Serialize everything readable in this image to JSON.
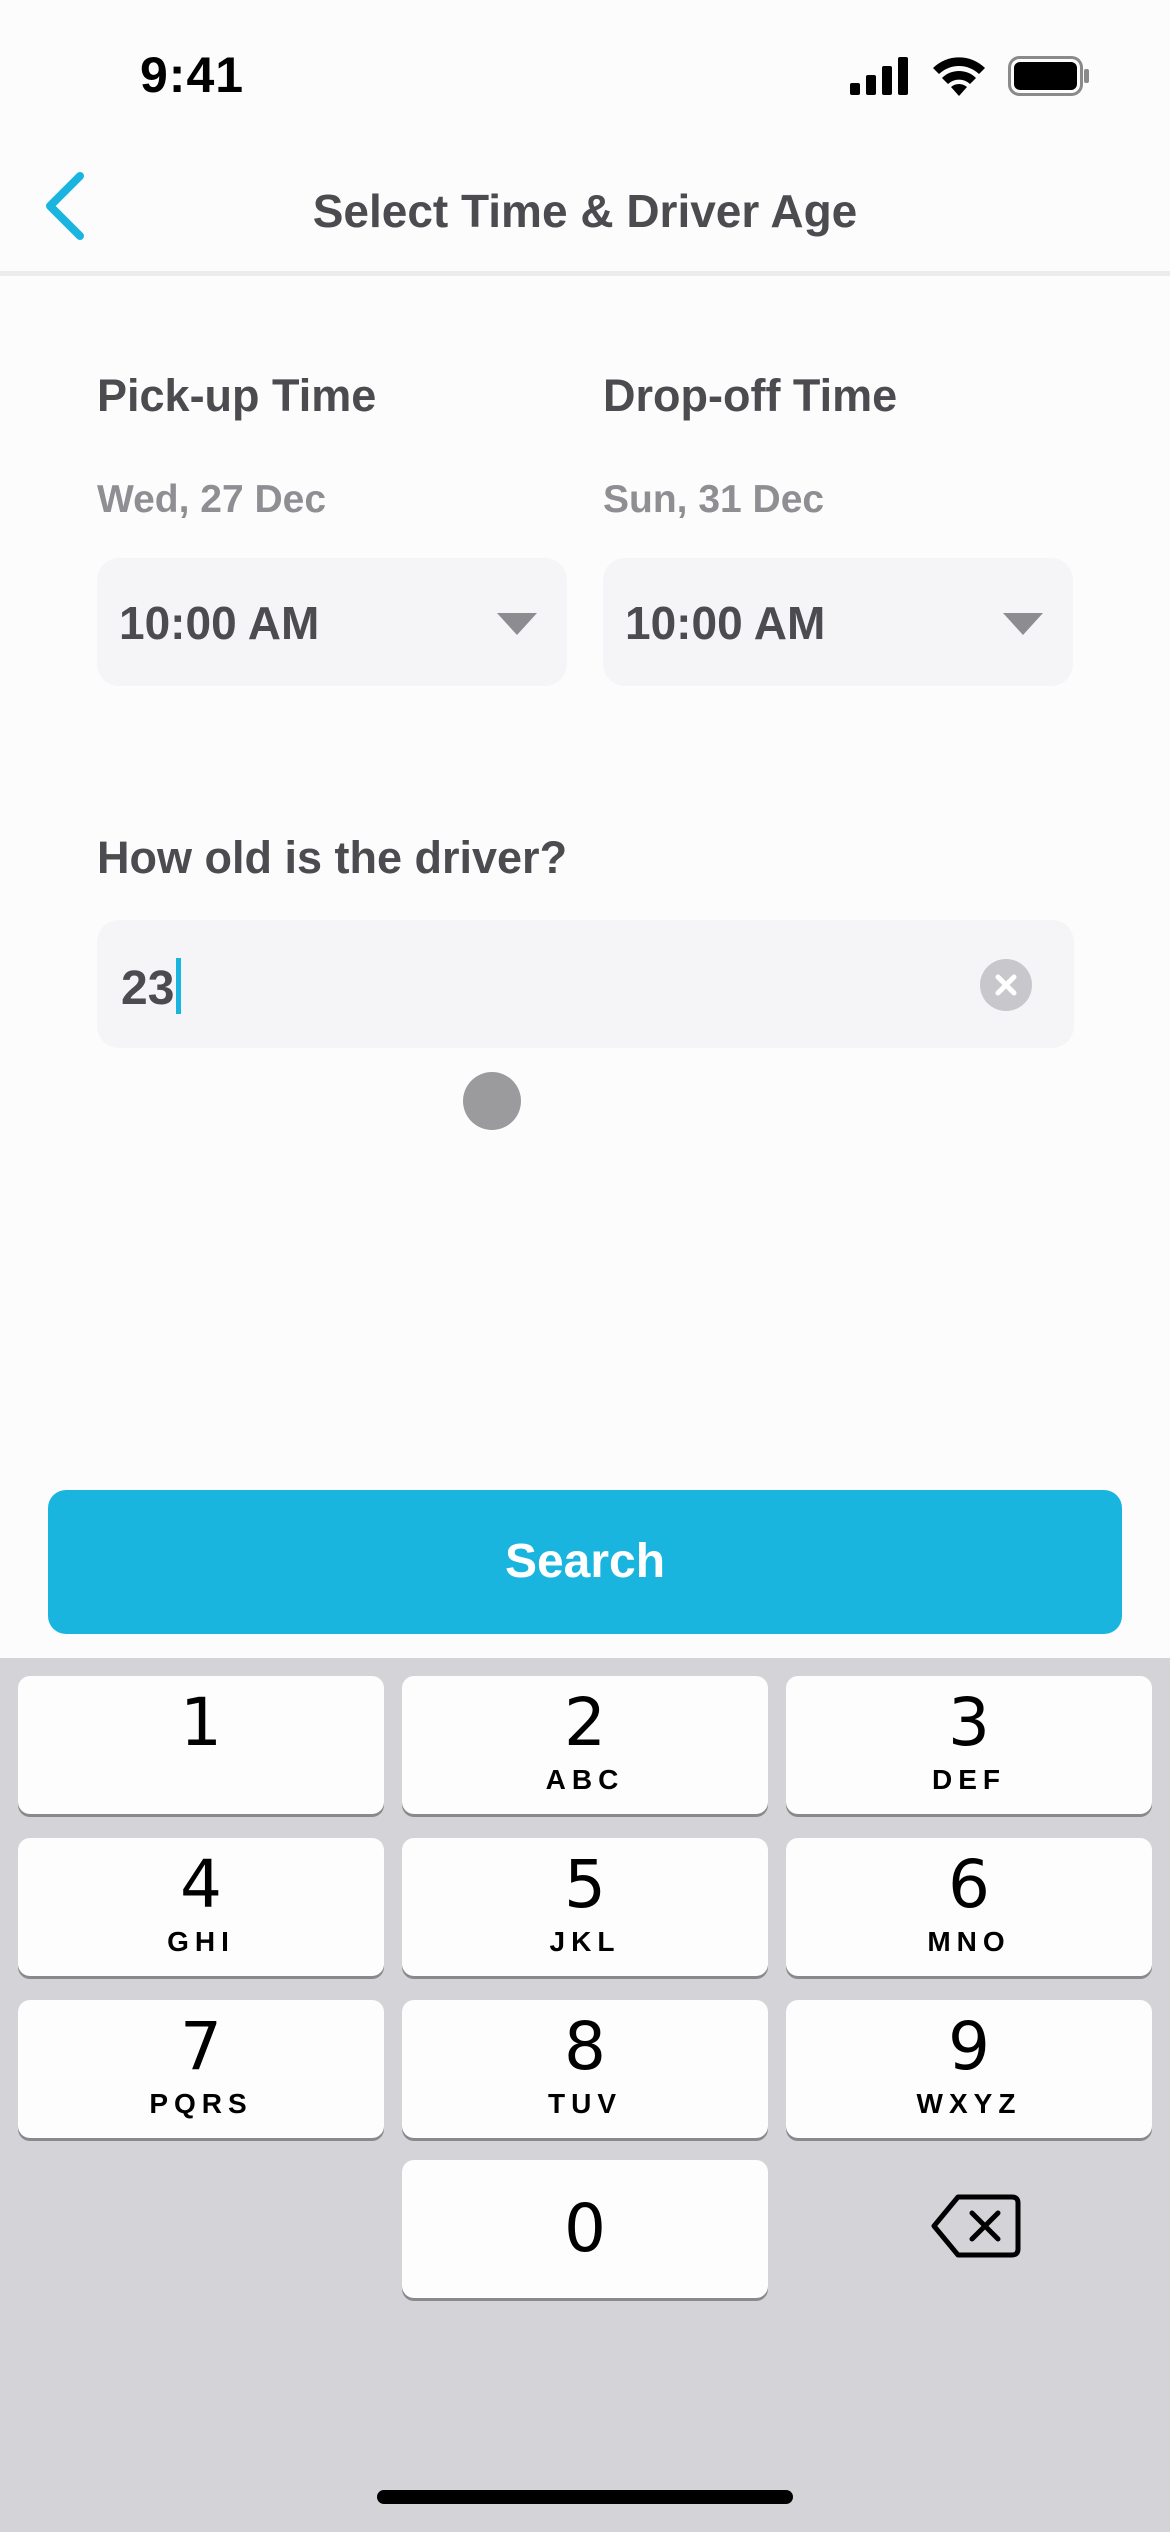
{
  "status_bar": {
    "time": "9:41",
    "icons": [
      "cellular-signal-icon",
      "wifi-icon",
      "battery-icon"
    ]
  },
  "nav": {
    "title": "Select Time & Driver Age",
    "back_icon": "chevron-left-icon"
  },
  "pickup": {
    "heading": "Pick-up Time",
    "date": "Wed, 27 Dec",
    "time": "10:00 AM"
  },
  "dropoff": {
    "heading": "Drop-off Time",
    "date": "Sun, 31 Dec",
    "time": "10:00 AM"
  },
  "driver_age": {
    "label": "How old is the driver?",
    "value": "23",
    "clear_icon": "clear-icon"
  },
  "search_button": {
    "label": "Search"
  },
  "colors": {
    "accent": "#19b5df",
    "field_bg": "#f5f4f7",
    "keyboard_bg": "#d3d3d8"
  },
  "keyboard": {
    "keys": [
      {
        "digit": "1",
        "letters": ""
      },
      {
        "digit": "2",
        "letters": "ABC"
      },
      {
        "digit": "3",
        "letters": "DEF"
      },
      {
        "digit": "4",
        "letters": "GHI"
      },
      {
        "digit": "5",
        "letters": "JKL"
      },
      {
        "digit": "6",
        "letters": "MNO"
      },
      {
        "digit": "7",
        "letters": "PQRS"
      },
      {
        "digit": "8",
        "letters": "TUV"
      },
      {
        "digit": "9",
        "letters": "WXYZ"
      },
      {
        "digit": "0",
        "letters": ""
      }
    ],
    "delete_icon": "backspace-icon"
  }
}
